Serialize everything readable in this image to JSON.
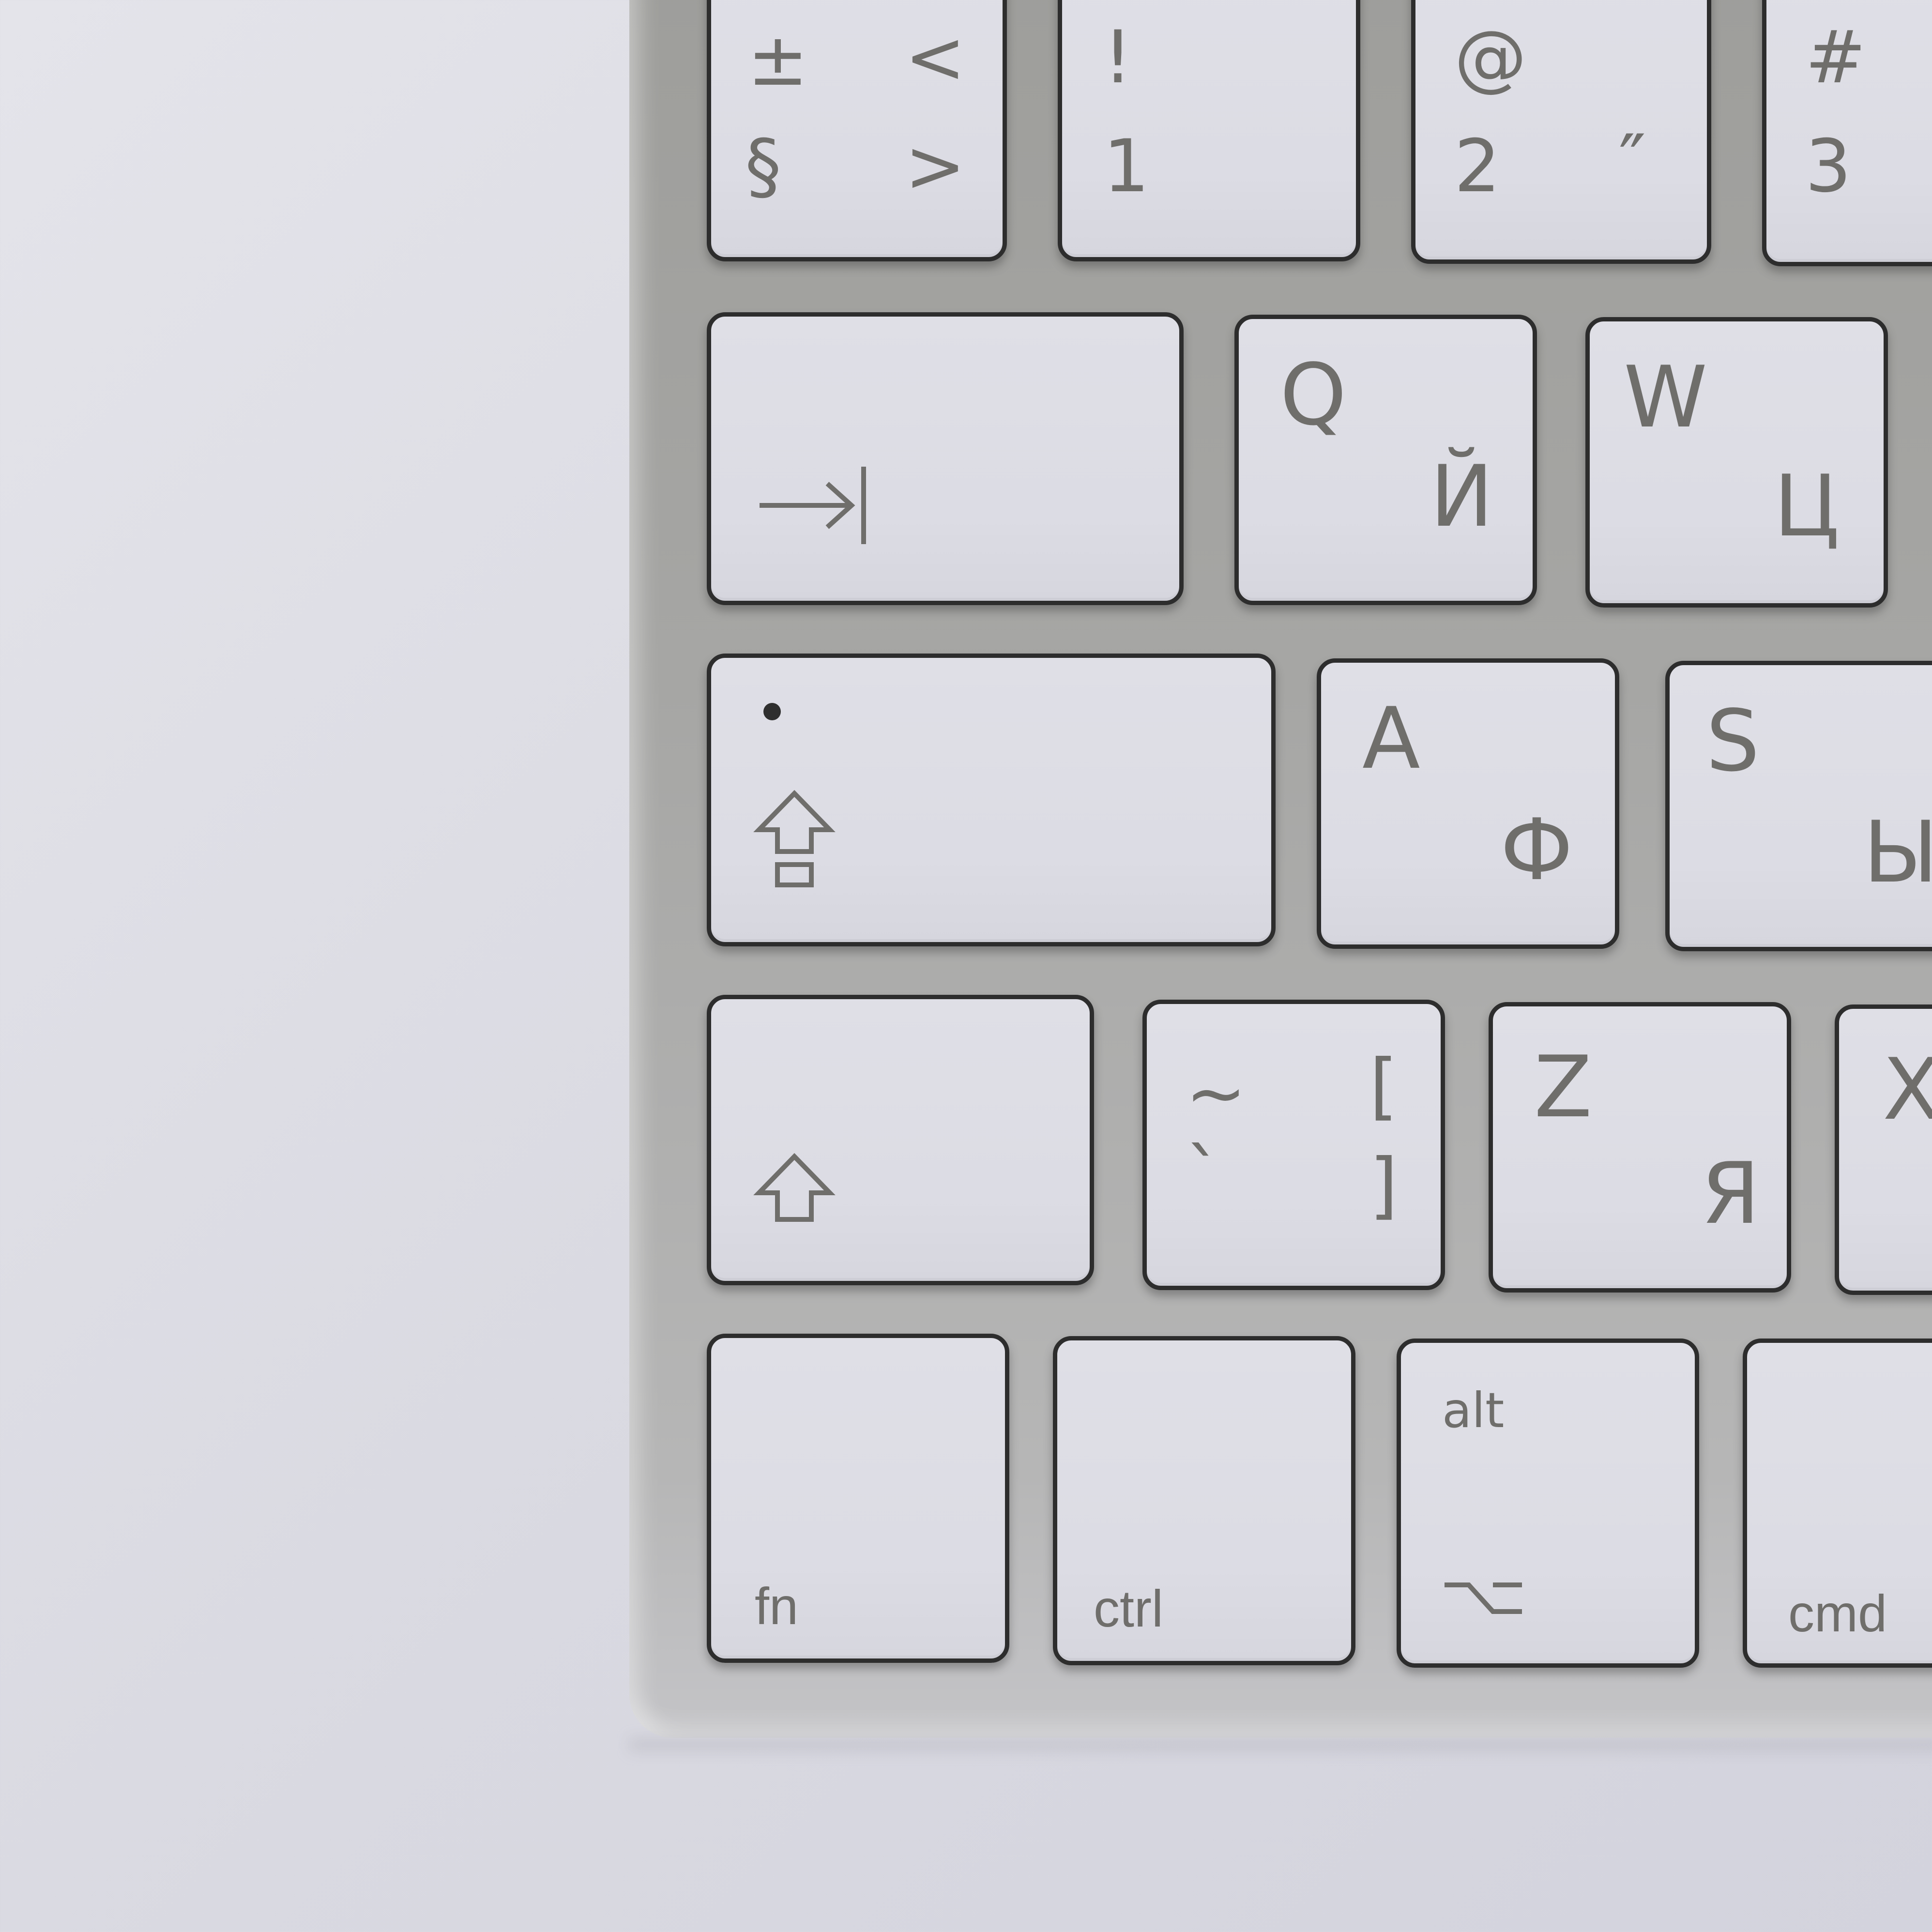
{
  "keys": {
    "section": {
      "top_shifted": "±",
      "top_right": "<",
      "bottom": "§",
      "bottom_right": ">"
    },
    "one": {
      "top": "!",
      "bottom": "1"
    },
    "two": {
      "top": "@",
      "bottom": "2",
      "bottom_right": "″"
    },
    "three": {
      "top": "#",
      "bottom": "3"
    },
    "tab": {
      "icon": "tab-arrow-icon"
    },
    "q": {
      "latin": "Q",
      "cyrillic": "Й"
    },
    "w": {
      "latin": "W",
      "cyrillic": "Ц"
    },
    "caps_lock": {
      "icon": "caps-lock-icon",
      "indicator": "indicator-light"
    },
    "a": {
      "latin": "A",
      "cyrillic": "Ф"
    },
    "s": {
      "latin": "S",
      "cyrillic": "Ы"
    },
    "shift": {
      "icon": "shift-arrow-icon"
    },
    "tilde": {
      "top_left": "~",
      "top_right": "[",
      "bottom_left": "`",
      "bottom_right": "]"
    },
    "z": {
      "latin": "Z",
      "cyrillic": "Я"
    },
    "x": {
      "latin": "X"
    },
    "fn": {
      "label": "fn"
    },
    "ctrl": {
      "label": "ctrl"
    },
    "alt": {
      "label": "alt",
      "icon": "option-icon"
    },
    "cmd": {
      "label": "cmd"
    }
  }
}
